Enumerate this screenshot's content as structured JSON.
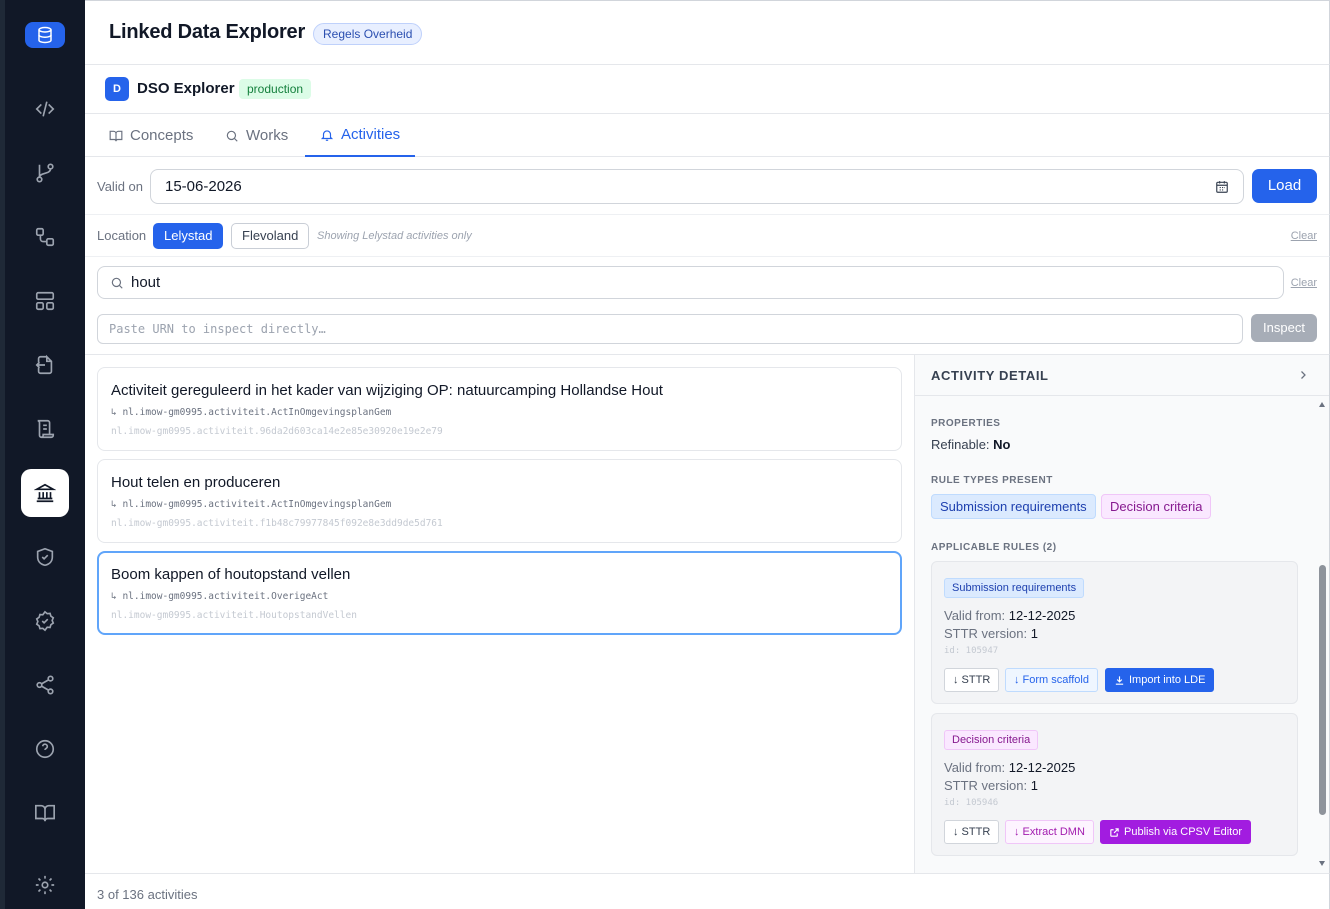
{
  "header": {
    "title": "Linked Data Explorer",
    "badge": "Regels Overheid"
  },
  "app": {
    "avatar_letter": "D",
    "name": "DSO Explorer",
    "environment": "production"
  },
  "tabs": [
    {
      "label": "Concepts",
      "icon": "book-icon"
    },
    {
      "label": "Works",
      "icon": "search-icon"
    },
    {
      "label": "Activities",
      "icon": "bell-icon",
      "active": true
    }
  ],
  "filters": {
    "valid_on_label": "Valid on",
    "valid_on_value": "15-06-2026",
    "load_label": "Load",
    "location_label": "Location",
    "locations": [
      {
        "label": "Lelystad",
        "selected": true
      },
      {
        "label": "Flevoland",
        "selected": false
      }
    ],
    "location_hint": "Showing Lelystad activities only",
    "clear_label": "Clear",
    "search_value": "hout",
    "urn_placeholder": "Paste URN to inspect directly…",
    "inspect_label": "Inspect"
  },
  "results": [
    {
      "title": "Activiteit gereguleerd in het kader van wijziging OP: natuurcamping Hollandse Hout",
      "type": "↳ nl.imow-gm0995.activiteit.ActInOmgevingsplanGem",
      "id": "nl.imow-gm0995.activiteit.96da2d603ca14e2e85e30920e19e2e79"
    },
    {
      "title": "Hout telen en produceren",
      "type": "↳ nl.imow-gm0995.activiteit.ActInOmgevingsplanGem",
      "id": "nl.imow-gm0995.activiteit.f1b48c79977845f092e8e3dd9de5d761"
    },
    {
      "title": "Boom kappen of houtopstand vellen",
      "type": "↳ nl.imow-gm0995.activiteit.OverigeAct",
      "id": "nl.imow-gm0995.activiteit.HoutopstandVellen",
      "selected": true
    }
  ],
  "detail": {
    "title": "ACTIVITY DETAIL",
    "properties_label": "PROPERTIES",
    "refinable_label": "Refinable:",
    "refinable_value": "No",
    "rule_types_label": "RULE TYPES PRESENT",
    "rule_types": [
      "Submission requirements",
      "Decision criteria"
    ],
    "applicable_rules_label": "APPLICABLE RULES (2)",
    "rules": [
      {
        "tag": "Submission requirements",
        "valid_from_label": "Valid from:",
        "valid_from": "12-12-2025",
        "version_label": "STTR version:",
        "version": "1",
        "id": "id: 105947",
        "buttons": [
          "↓ STTR",
          "↓ Form scaffold",
          "Import into LDE"
        ]
      },
      {
        "tag": "Decision criteria",
        "valid_from_label": "Valid from:",
        "valid_from": "12-12-2025",
        "version_label": "STTR version:",
        "version": "1",
        "id": "id: 105946",
        "buttons": [
          "↓ STTR",
          "↓ Extract DMN",
          "Publish via CPSV Editor"
        ]
      }
    ]
  },
  "footer": {
    "count_text": "3 of 136 activities"
  },
  "sidebar": {
    "items": [
      "code-icon",
      "git-branch-icon",
      "flow-icon",
      "layout-icon",
      "import-icon",
      "scroll-icon",
      "landmark-icon",
      "shield-check-icon",
      "badge-check-icon",
      "share-icon",
      "help-icon",
      "book-open-icon",
      "settings-icon"
    ],
    "active": "landmark-icon"
  },
  "colors": {
    "primary": "#2563eb",
    "sidebar": "#111827",
    "env_green": "#15803d",
    "purple": "#a21ce0"
  }
}
